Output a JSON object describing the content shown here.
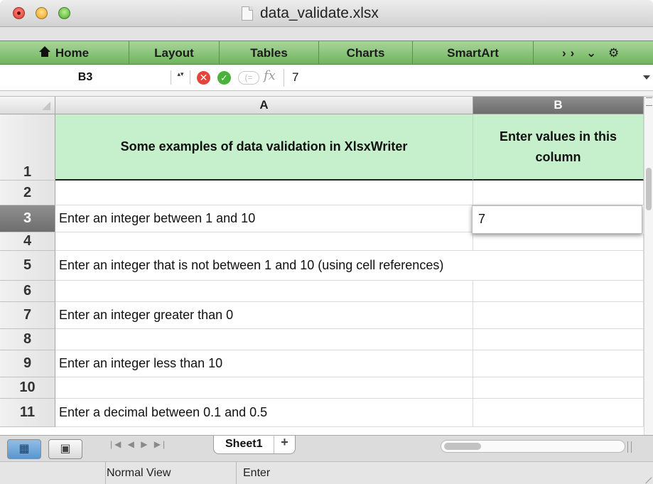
{
  "window": {
    "title": "data_validate.xlsx"
  },
  "ribbon": {
    "tabs": [
      "Home",
      "Layout",
      "Tables",
      "Charts",
      "SmartArt"
    ],
    "more_glyphs": "›› ⌄ ⚙"
  },
  "formula_bar": {
    "name_box": "B3",
    "stepper_glyph": "▴▾",
    "cancel_glyph": "✕",
    "confirm_glyph": "✓",
    "func_glyph": "(=",
    "fx_label": "fx",
    "value": "7"
  },
  "grid": {
    "columns": [
      "A",
      "B"
    ],
    "selected_column": "B",
    "selected_row": "3",
    "rows": [
      {
        "num": "1",
        "a": "Some examples of data validation in XlsxWriter",
        "b": "Enter values in this column"
      },
      {
        "num": "2",
        "a": "",
        "b": ""
      },
      {
        "num": "3",
        "a": "Enter an integer between 1 and 10",
        "b": "7"
      },
      {
        "num": "4",
        "a": "",
        "b": ""
      },
      {
        "num": "5",
        "a": "Enter an integer that is not between 1 and 10 (using cell references)",
        "b": ""
      },
      {
        "num": "6",
        "a": "",
        "b": ""
      },
      {
        "num": "7",
        "a": "Enter an integer greater than 0",
        "b": ""
      },
      {
        "num": "8",
        "a": "",
        "b": ""
      },
      {
        "num": "9",
        "a": "Enter an integer less than 10",
        "b": ""
      },
      {
        "num": "10",
        "a": "",
        "b": ""
      },
      {
        "num": "11",
        "a": "Enter a decimal between 0.1 and 0.5",
        "b": ""
      }
    ],
    "header_fill": "#c6efcb"
  },
  "sheets": {
    "tabs": [
      "Sheet1"
    ],
    "add_glyph": "+",
    "nav_glyphs": "|◀ ◀ ▶ ▶|"
  },
  "status": {
    "view_mode": "Normal View",
    "state": "Enter"
  }
}
